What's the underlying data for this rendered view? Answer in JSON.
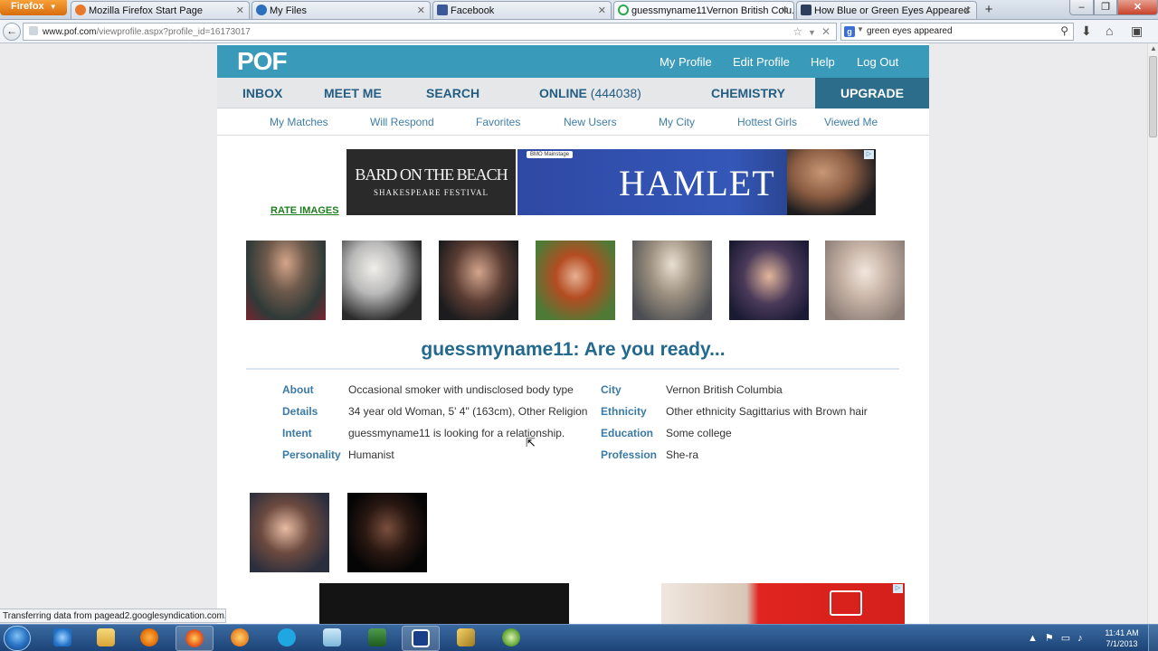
{
  "browser": {
    "menu_label": "Firefox",
    "tabs": [
      {
        "label": "Mozilla Firefox Start Page",
        "active": false
      },
      {
        "label": "My Files",
        "active": false
      },
      {
        "label": "Facebook",
        "active": false
      },
      {
        "label": "guessmyname11Vernon British Colu...",
        "active": true
      },
      {
        "label": "How Blue or Green Eyes Appeared",
        "active": false
      }
    ],
    "url_domain": "www.pof.com",
    "url_path": "/viewprofile.aspx?profile_id=16173017",
    "search_query": "green eyes appeared",
    "status_text": "Transferring data from pagead2.googlesyndication.com..."
  },
  "pof": {
    "logo": "POF",
    "top_links": [
      "My Profile",
      "Edit Profile",
      "Help",
      "Log Out"
    ],
    "main_nav": {
      "inbox": "INBOX",
      "meet_me": "MEET ME",
      "search": "SEARCH",
      "online": "ONLINE",
      "online_count": "(444038)",
      "chemistry": "CHEMISTRY",
      "upgrade": "UPGRADE"
    },
    "sub_nav": [
      "My Matches",
      "Will Respond",
      "Favorites",
      "New Users",
      "My City",
      "Hottest Girls",
      "Viewed Me"
    ],
    "rate_images": "RATE IMAGES",
    "ad": {
      "bard_line1": "BARD ON THE BEACH",
      "bard_line2": "SHAKESPEARE FESTIVAL",
      "sponsor": "BMO Mainstage",
      "title": "HAMLET"
    },
    "profile_title": "guessmyname11: Are you ready...",
    "details_left": [
      {
        "label": "About",
        "value": "Occasional smoker with undisclosed body type"
      },
      {
        "label": "Details",
        "value": "34 year old Woman, 5' 4\" (163cm), Other Religion"
      },
      {
        "label": "Intent",
        "value": "guessmyname11 is looking for a relationship."
      },
      {
        "label": "Personality",
        "value": "Humanist"
      }
    ],
    "details_right": [
      {
        "label": "City",
        "value": "Vernon British Columbia"
      },
      {
        "label": "Ethnicity",
        "value": "Other ethnicity Sagittarius with Brown hair"
      },
      {
        "label": "Education",
        "value": "Some college"
      },
      {
        "label": "Profession",
        "value": "She-ra"
      }
    ]
  },
  "taskbar": {
    "time": "11:41 AM",
    "date": "7/1/2013"
  },
  "colors": {
    "pof_header": "#3a9ab9",
    "upgrade_bg": "#2d6d8c",
    "nav_text": "#245e83",
    "link_blue": "#3f7ea8",
    "title_blue": "#23698e",
    "rate_green": "#1e7e1e"
  }
}
